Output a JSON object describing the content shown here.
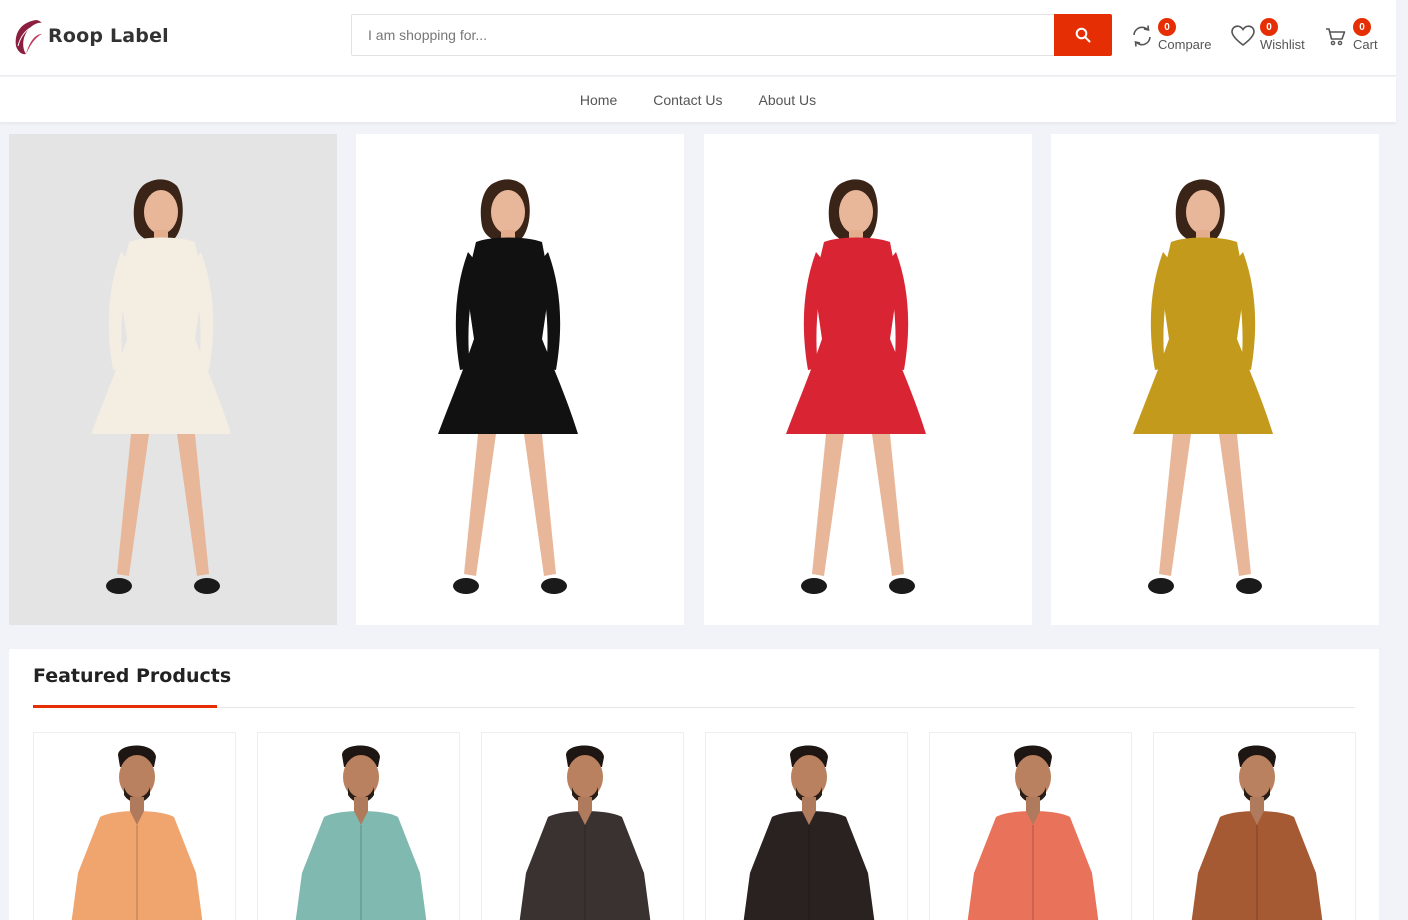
{
  "brand": {
    "name": "Roop Label"
  },
  "search": {
    "placeholder": "I am shopping for..."
  },
  "header_icons": {
    "compare": {
      "label": "Compare",
      "count": "0"
    },
    "wishlist": {
      "label": "Wishlist",
      "count": "0"
    },
    "cart": {
      "label": "Cart",
      "count": "0"
    }
  },
  "nav": {
    "items": [
      "Home",
      "Contact Us",
      "About Us"
    ]
  },
  "featured": {
    "title": "Featured Products"
  },
  "colors": {
    "accent": "#e62e04",
    "page_bg": "#f2f3f8"
  },
  "banners": [
    {
      "dress_color": "#f3ede2",
      "bg": "#e4e4e4"
    },
    {
      "dress_color": "#111111",
      "bg": "#ffffff"
    },
    {
      "dress_color": "#d92433",
      "bg": "#ffffff"
    },
    {
      "dress_color": "#c39a1c",
      "bg": "#ffffff"
    }
  ],
  "products": [
    {
      "shirt_color": "#f0a46e"
    },
    {
      "shirt_color": "#7fb9b0"
    },
    {
      "shirt_color": "#3a3230"
    },
    {
      "shirt_color": "#2a2220"
    },
    {
      "shirt_color": "#e8735a"
    },
    {
      "shirt_color": "#a55a34"
    }
  ]
}
